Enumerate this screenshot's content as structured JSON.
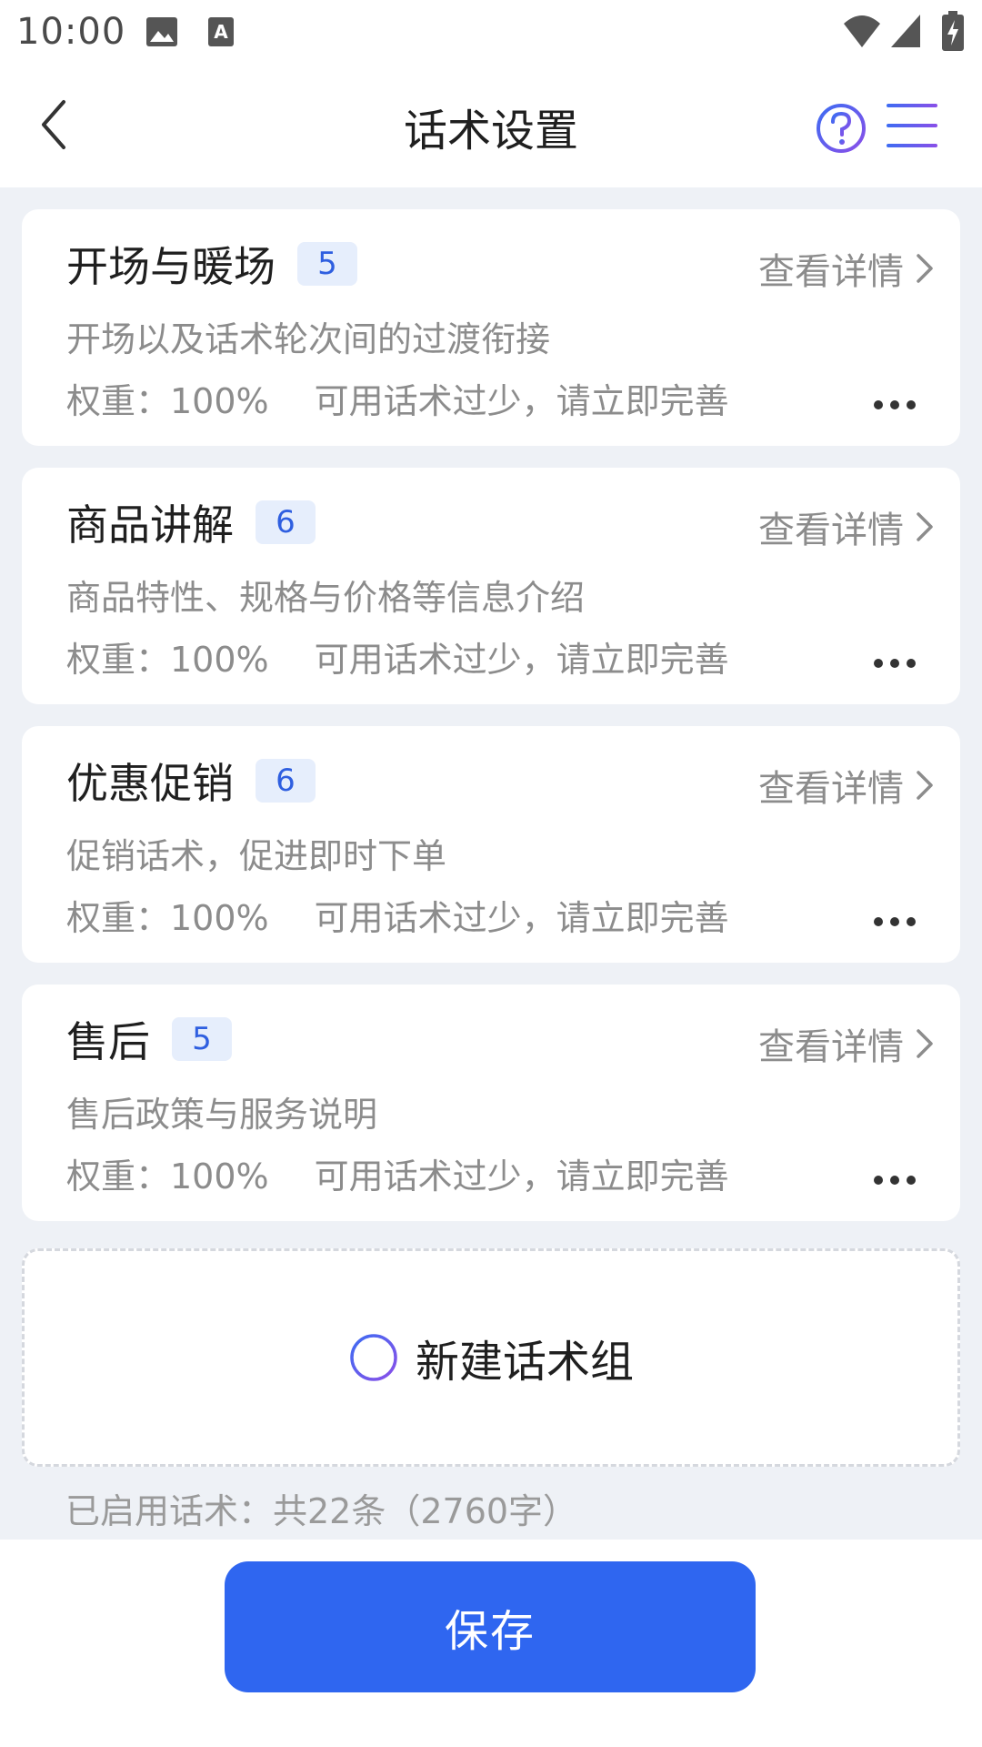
{
  "status_bar": {
    "time": "10:00",
    "icons": [
      "image-icon",
      "font-icon",
      "wifi-icon",
      "signal-icon",
      "battery-charging-icon"
    ]
  },
  "nav": {
    "title": "话术设置",
    "back_icon": "chevron-left-icon",
    "help_icon": "help-circle-icon",
    "menu_icon": "menu-icon"
  },
  "colors": {
    "accent": "#2f66f0",
    "badge_bg": "#e6eefc",
    "badge_text": "#2f5fe0",
    "background": "#eef1f6",
    "muted_text": "#8c8c8c"
  },
  "cards": [
    {
      "title": "开场与暖场",
      "count": "5",
      "detail": "查看详情",
      "description": "开场以及话术轮次间的过渡衔接",
      "weight": "权重：100%",
      "warning": "可用话术过少，请立即完善"
    },
    {
      "title": "商品讲解",
      "count": "6",
      "detail": "查看详情",
      "description": "商品特性、规格与价格等信息介绍",
      "weight": "权重：100%",
      "warning": "可用话术过少，请立即完善"
    },
    {
      "title": "优惠促销",
      "count": "6",
      "detail": "查看详情",
      "description": "促销话术，促进即时下单",
      "weight": "权重：100%",
      "warning": "可用话术过少，请立即完善"
    },
    {
      "title": "售后",
      "count": "5",
      "detail": "查看详情",
      "description": "售后政策与服务说明",
      "weight": "权重：100%",
      "warning": "可用话术过少，请立即完善"
    }
  ],
  "new_group": {
    "label": "新建话术组",
    "icon": "plus-circle-icon"
  },
  "summary": "已启用话术：共22条（2760字）",
  "footer": {
    "save_label": "保存"
  }
}
